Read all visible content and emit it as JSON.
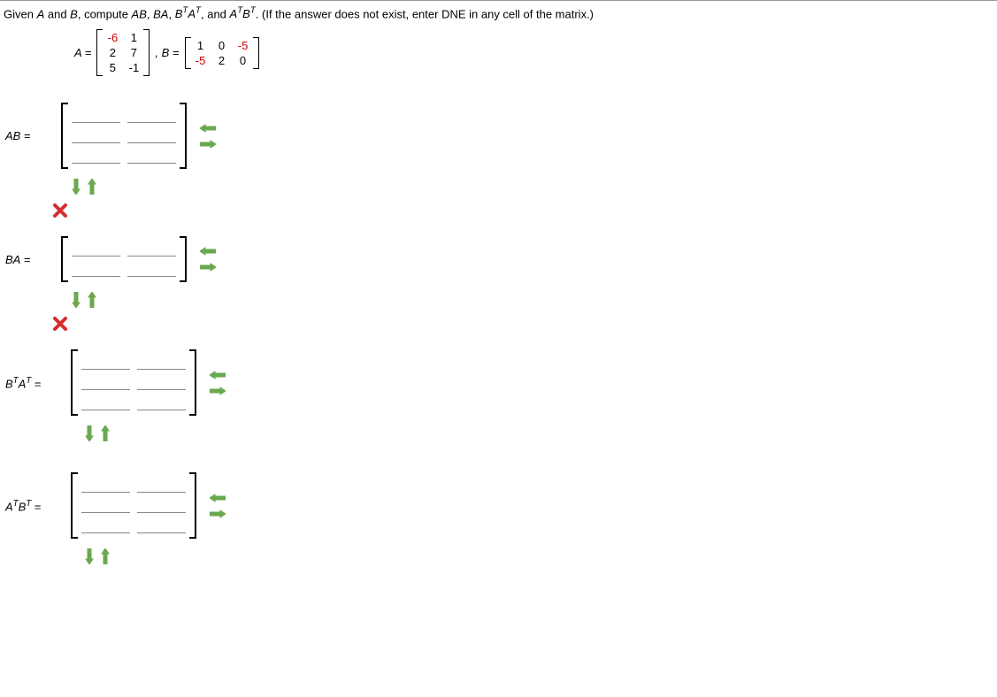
{
  "prompt": {
    "prefix": "Given ",
    "a": "A",
    "and_txt": " and ",
    "b": "B",
    "compute_txt": ", compute ",
    "ab": "AB",
    "c1": ", ",
    "ba": "BA",
    "c2": ", ",
    "btat_pre": "B",
    "t_sup": "T",
    "atat_mid": "A",
    "c3": ", and ",
    "atbt_a": "A",
    "atbt_b": "B",
    "tail": ". (If the answer does not exist, enter DNE in any cell of the matrix.)"
  },
  "given": {
    "a_label": "A =",
    "b_label": ", B =",
    "A": [
      [
        "-6",
        "1"
      ],
      [
        "2",
        "7"
      ],
      [
        "5",
        "-1"
      ]
    ],
    "B": [
      [
        "1",
        "0",
        "-5"
      ],
      [
        "-5",
        "2",
        "0"
      ]
    ]
  },
  "answers": {
    "ab": {
      "label_html": "AB",
      "rows": 3,
      "cols": 2,
      "incorrect": true
    },
    "ba": {
      "label_html": "BA",
      "rows": 2,
      "cols": 2,
      "incorrect": true
    },
    "btat": {
      "label_html": "BTAT",
      "rows": 3,
      "cols": 2,
      "incorrect": false
    },
    "atbt": {
      "label_html": "ATBT",
      "rows": 3,
      "cols": 2,
      "incorrect": false
    }
  },
  "eq": " ="
}
